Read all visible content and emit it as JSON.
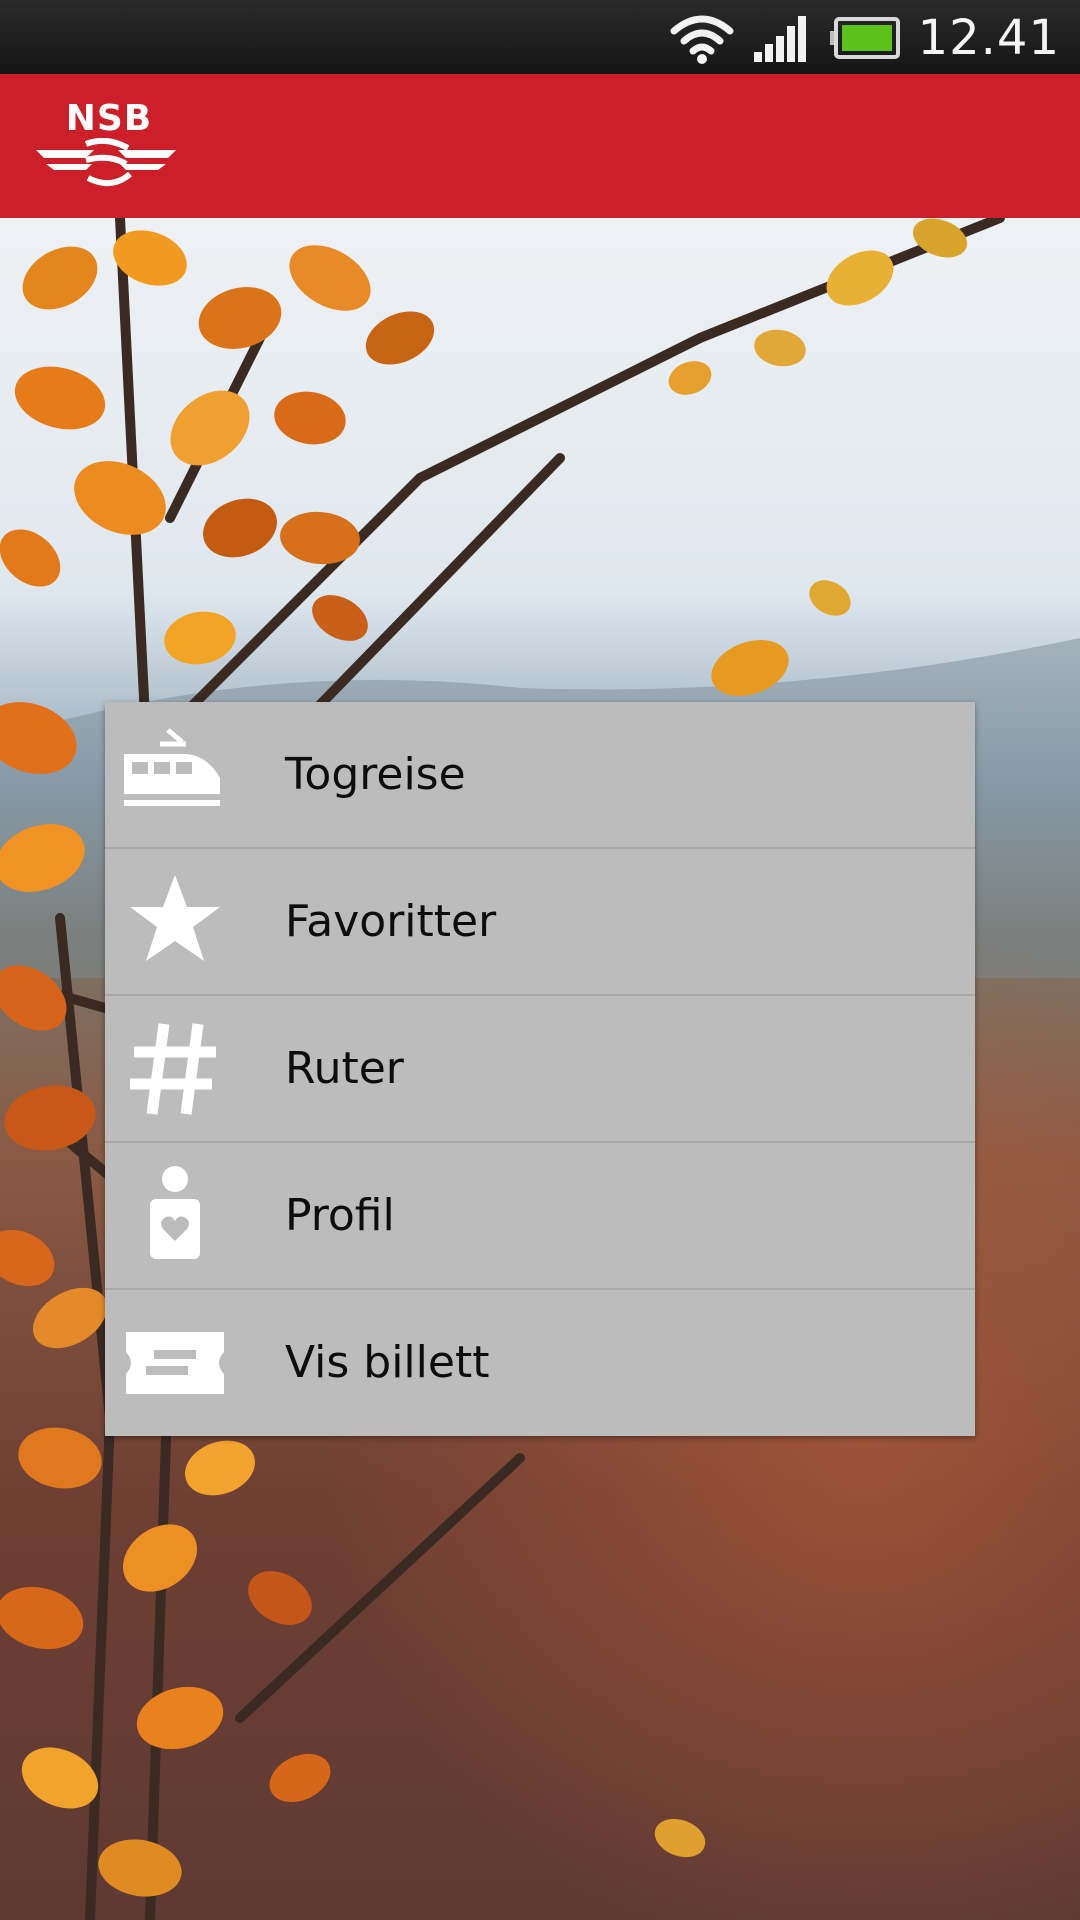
{
  "status_bar": {
    "time": "12.41",
    "wifi_icon": "wifi-icon",
    "signal_icon": "signal-icon",
    "battery_icon": "battery-icon",
    "battery_color": "#5ac21a"
  },
  "app_bar": {
    "logo_text": "NSB",
    "color": "#cc1f29"
  },
  "menu": {
    "items": [
      {
        "label": "Togreise",
        "icon": "train-icon"
      },
      {
        "label": "Favoritter",
        "icon": "star-icon"
      },
      {
        "label": "Ruter",
        "icon": "hash-icon"
      },
      {
        "label": "Profil",
        "icon": "profile-icon"
      },
      {
        "label": "Vis billett",
        "icon": "ticket-icon"
      }
    ]
  }
}
